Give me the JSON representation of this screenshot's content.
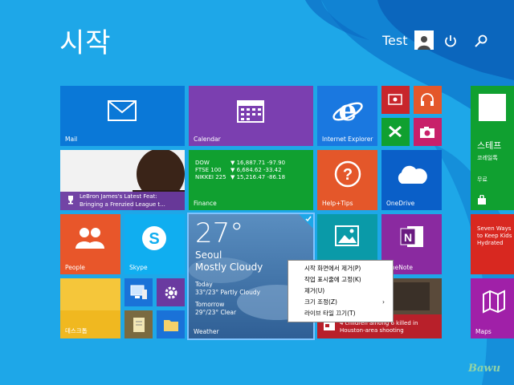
{
  "screen": {
    "title": "시작",
    "accent": "#1ea7e8"
  },
  "user": {
    "name": "Test"
  },
  "tiles": {
    "mail": "Mail",
    "calendar": "Calendar",
    "ie": "Internet Explorer",
    "news": "LeBron James's Latest Feat: Bringing a Frenzied League t...",
    "news_line1": "LeBron James's Latest Feat:",
    "news_line2": "Bringing a Frenzied League t...",
    "finance": {
      "label": "Finance",
      "rows": [
        {
          "name": "DOW",
          "value": "▼ 16,887.71 -97.90"
        },
        {
          "name": "FTSE 100",
          "value": "▼ 6,684.62 -33.42"
        },
        {
          "name": "NIKKEI 225",
          "value": "▼ 15,216.47 -86.18"
        }
      ]
    },
    "help": "Help+Tips",
    "onedrive": "OneDrive",
    "people": "People",
    "skype": "Skype",
    "weather": {
      "label": "Weather",
      "temp": "27°",
      "city": "Seoul",
      "condition": "Mostly Cloudy",
      "today_label": "Today",
      "today": "33°/23° Partly Cloudy",
      "tomorrow_label": "Tomorrow",
      "tomorrow": "29°/23° Clear"
    },
    "onenote": "OneNote",
    "desktop": "데스크톱",
    "store": {
      "title": "스테프",
      "subtitle": "코레일톡",
      "price": "무료"
    },
    "health": "Seven Ways to Keep Kids Hydrated",
    "houston": "4 children among 6 killed in Houston-area shooting",
    "maps": "Maps"
  },
  "context_menu": {
    "items": [
      "시작 화면에서 제거(P)",
      "작업 표시줄에 고정(K)",
      "제거(U)",
      "크기 조정(Z)",
      "라이브 타일 끄기(T)"
    ],
    "submenu_arrow": "›"
  },
  "watermark": "Bawu"
}
